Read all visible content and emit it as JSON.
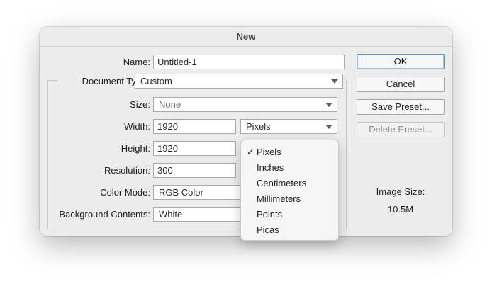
{
  "dialog": {
    "title": "New",
    "name_label": "Name:",
    "name_value": "Untitled-1",
    "document_type_label": "Document Type:",
    "document_type_value": "Custom",
    "size_label": "Size:",
    "size_value": "None",
    "width_label": "Width:",
    "width_value": "1920",
    "width_unit": "Pixels",
    "height_label": "Height:",
    "height_value": "1920",
    "resolution_label": "Resolution:",
    "resolution_value": "300",
    "color_mode_label": "Color Mode:",
    "color_mode_value": "RGB Color",
    "background_label": "Background Contents:",
    "background_value": "White",
    "image_size_label": "Image Size:",
    "image_size_value": "10.5M"
  },
  "buttons": {
    "ok": "OK",
    "cancel": "Cancel",
    "save_preset": "Save Preset...",
    "delete_preset": "Delete Preset..."
  },
  "unit_menu": {
    "check_mark": "✓",
    "items": [
      "Pixels",
      "Inches",
      "Centimeters",
      "Millimeters",
      "Points",
      "Picas"
    ],
    "selected": "Pixels"
  },
  "icons": {
    "dropdown_arrow": "chevron-down-icon",
    "check": "checkmark-icon"
  }
}
